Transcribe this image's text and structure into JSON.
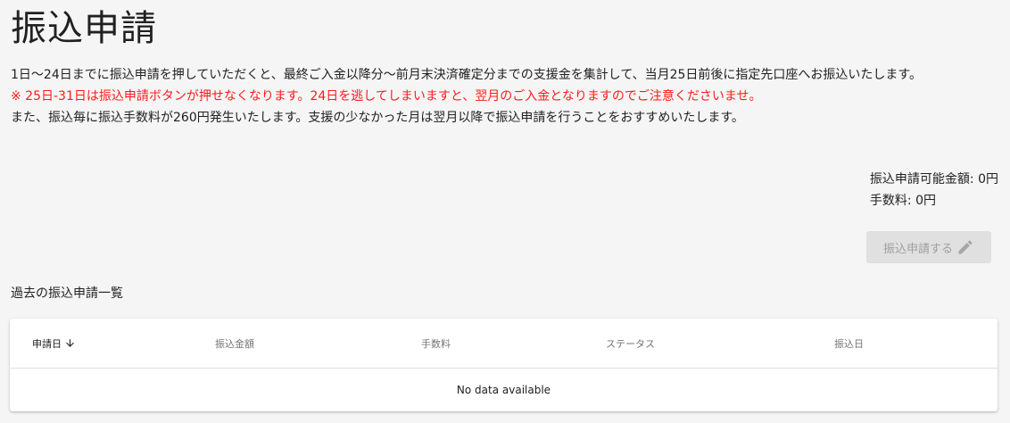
{
  "page": {
    "title": "振込申請"
  },
  "description": {
    "line1": "1日〜24日までに振込申請を押していただくと、最終ご入金以降分〜前月末決済確定分までの支援金を集計して、当月25日前後に指定先口座へお振込いたします。",
    "warning": "※ 25日-31日は振込申請ボタンが押せなくなります。24日を逃してしまいますと、翌月のご入金となりますのでご注意くださいませ。",
    "line3": "また、振込毎に振込手数料が260円発生いたします。支援の少なかった月は翌月以降で振込申請を行うことをおすすめいたします。"
  },
  "amounts": {
    "available": "振込申請可能金額: 0円",
    "fee": "手数料: 0円"
  },
  "apply_button": {
    "label": "振込申請する",
    "icon": "pencil-icon",
    "disabled": true
  },
  "history": {
    "title": "過去の振込申請一覧",
    "columns": [
      {
        "label": "申請日",
        "sorted": "desc",
        "icon": "arrow-down-icon"
      },
      {
        "label": "振込金額"
      },
      {
        "label": "手数料"
      },
      {
        "label": "ステータス"
      },
      {
        "label": "振込日"
      }
    ],
    "rows": [],
    "empty_text": "No data available"
  },
  "colors": {
    "background": "#f5f5f5",
    "warning": "#ff1a1a",
    "button_disabled_bg": "#e0e0e0",
    "button_disabled_text": "#9e9e9e"
  }
}
